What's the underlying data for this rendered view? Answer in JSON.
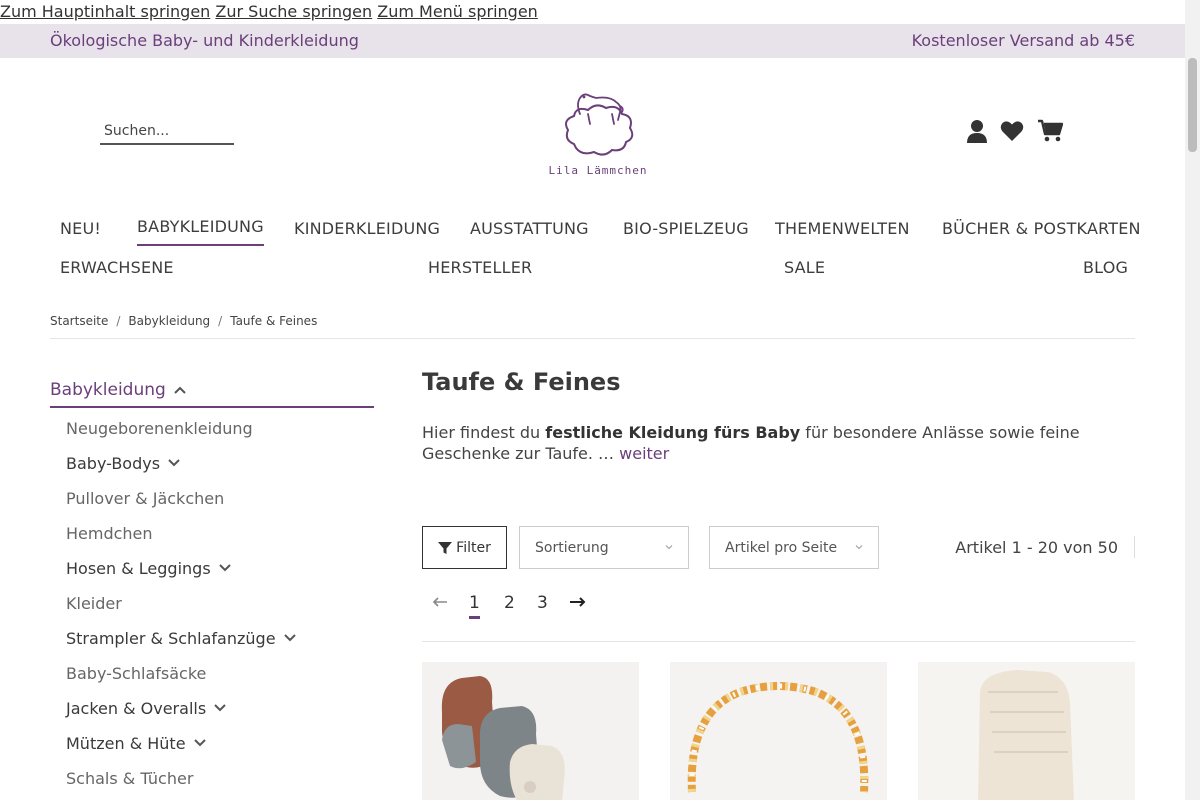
{
  "skip_links": [
    "Zum Hauptinhalt springen",
    "Zur Suche springen",
    "Zum Menü springen"
  ],
  "topbar": {
    "left": "Ökologische Baby- und Kinderkleidung",
    "right": "Kostenloser Versand ab 45€"
  },
  "search": {
    "placeholder": "Suchen..."
  },
  "logo": {
    "brand": "Lila Lämmchen"
  },
  "header_icons": [
    "user-icon",
    "heart-icon",
    "cart-icon"
  ],
  "nav": {
    "row1": [
      "NEU!",
      "BABYKLEIDUNG",
      "KINDERKLEIDUNG",
      "AUSSTATTUNG",
      "BIO-SPIELZEUG",
      "THEMENWELTEN",
      "BÜCHER & POSTKARTEN"
    ],
    "row2": [
      "ERWACHSENE",
      "HERSTELLER",
      "SALE",
      "BLOG"
    ],
    "active": "BABYKLEIDUNG"
  },
  "breadcrumb": [
    "Startseite",
    "Babykleidung",
    "Taufe & Feines"
  ],
  "sidebar": {
    "heading": "Babykleidung",
    "items": [
      {
        "label": "Neugeborenenkleidung",
        "expandable": false
      },
      {
        "label": "Baby-Bodys",
        "expandable": true
      },
      {
        "label": "Pullover & Jäckchen",
        "expandable": false
      },
      {
        "label": "Hemdchen",
        "expandable": false
      },
      {
        "label": "Hosen & Leggings",
        "expandable": true
      },
      {
        "label": "Kleider",
        "expandable": false
      },
      {
        "label": "Strampler & Schlafanzüge",
        "expandable": true
      },
      {
        "label": "Baby-Schlafsäcke",
        "expandable": false
      },
      {
        "label": "Jacken & Overalls",
        "expandable": true
      },
      {
        "label": "Mützen & Hüte",
        "expandable": true
      },
      {
        "label": "Schals & Tücher",
        "expandable": false
      }
    ]
  },
  "main": {
    "title": "Taufe & Feines",
    "desc_pre": "Hier findest du ",
    "desc_bold": "festliche Kleidung fürs Baby",
    "desc_post": " für besondere Anlässe sowie feine Geschenke zur Taufe. … ",
    "desc_more": "weiter",
    "filter_label": "Filter",
    "sort_label": "Sortierung",
    "per_page_label": "Artikel pro Seite",
    "count_text": "Artikel 1 - 20 von 50",
    "pages": [
      "1",
      "2",
      "3"
    ],
    "current_page": "1"
  },
  "colors": {
    "accent": "#6a3f7a",
    "topbar_bg": "#e8e2ea"
  }
}
